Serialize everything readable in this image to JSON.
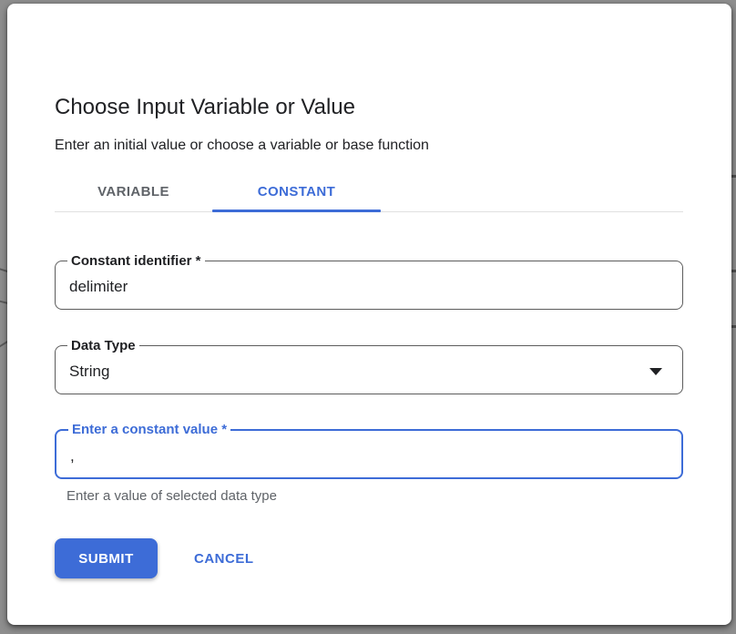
{
  "dialog": {
    "title": "Choose Input Variable or Value",
    "subtitle": "Enter an initial value or choose a variable or base function",
    "tabs": [
      {
        "label": "VARIABLE",
        "active": false
      },
      {
        "label": "CONSTANT",
        "active": true
      }
    ],
    "fields": {
      "identifier": {
        "label": "Constant identifier *",
        "value": "delimiter"
      },
      "data_type": {
        "label": "Data Type",
        "value": "String"
      },
      "constant_value": {
        "label": "Enter a constant value *",
        "value": ",",
        "helper": "Enter a value of selected data type"
      }
    },
    "buttons": {
      "submit": "SUBMIT",
      "cancel": "CANCEL"
    }
  },
  "colors": {
    "accent": "#3d6cd7",
    "backdrop": "#8e8e8e",
    "text_primary": "#202124",
    "text_secondary": "#5f6368",
    "field_border": "#5c5c5c",
    "tab_divider": "#e0e0e0"
  }
}
